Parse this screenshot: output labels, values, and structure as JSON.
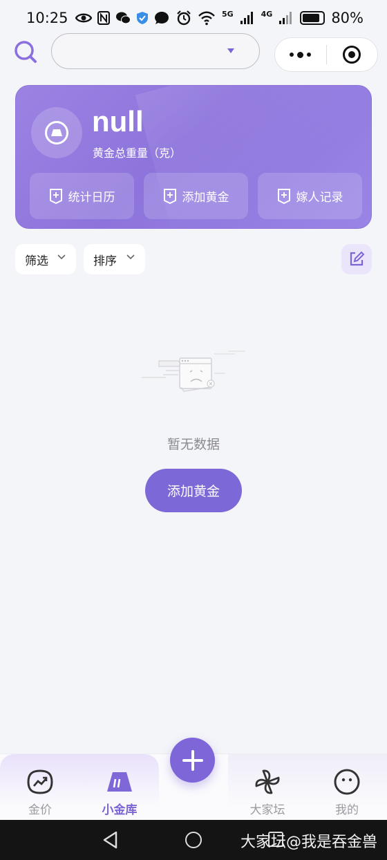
{
  "status_bar": {
    "time": "10:25",
    "battery": "80%",
    "net1": "5G",
    "net2": "4G"
  },
  "summary": {
    "weight_value": "null",
    "weight_label": "黄金总重量（克）",
    "actions": [
      {
        "label": "统计日历",
        "icon": "plus-square-icon"
      },
      {
        "label": "添加黄金",
        "icon": "plus-square-icon"
      },
      {
        "label": "嫁人记录",
        "icon": "plus-square-icon"
      }
    ]
  },
  "filters": {
    "filter_label": "筛选",
    "sort_label": "排序"
  },
  "empty_state": {
    "text": "暂无数据",
    "button_label": "添加黄金"
  },
  "tab_bar": {
    "tabs": [
      {
        "label": "金价",
        "icon": "trend-chart-icon"
      },
      {
        "label": "小金库",
        "icon": "gold-bar-icon",
        "active": true
      },
      {
        "label": "大家坛",
        "icon": "pinwheel-icon"
      },
      {
        "label": "我的",
        "icon": "face-icon"
      }
    ]
  },
  "watermark": "大家坛@我是吞金兽",
  "colors": {
    "accent": "#7c63d6",
    "card": "#9580e0",
    "background": "#f4f5f9"
  }
}
